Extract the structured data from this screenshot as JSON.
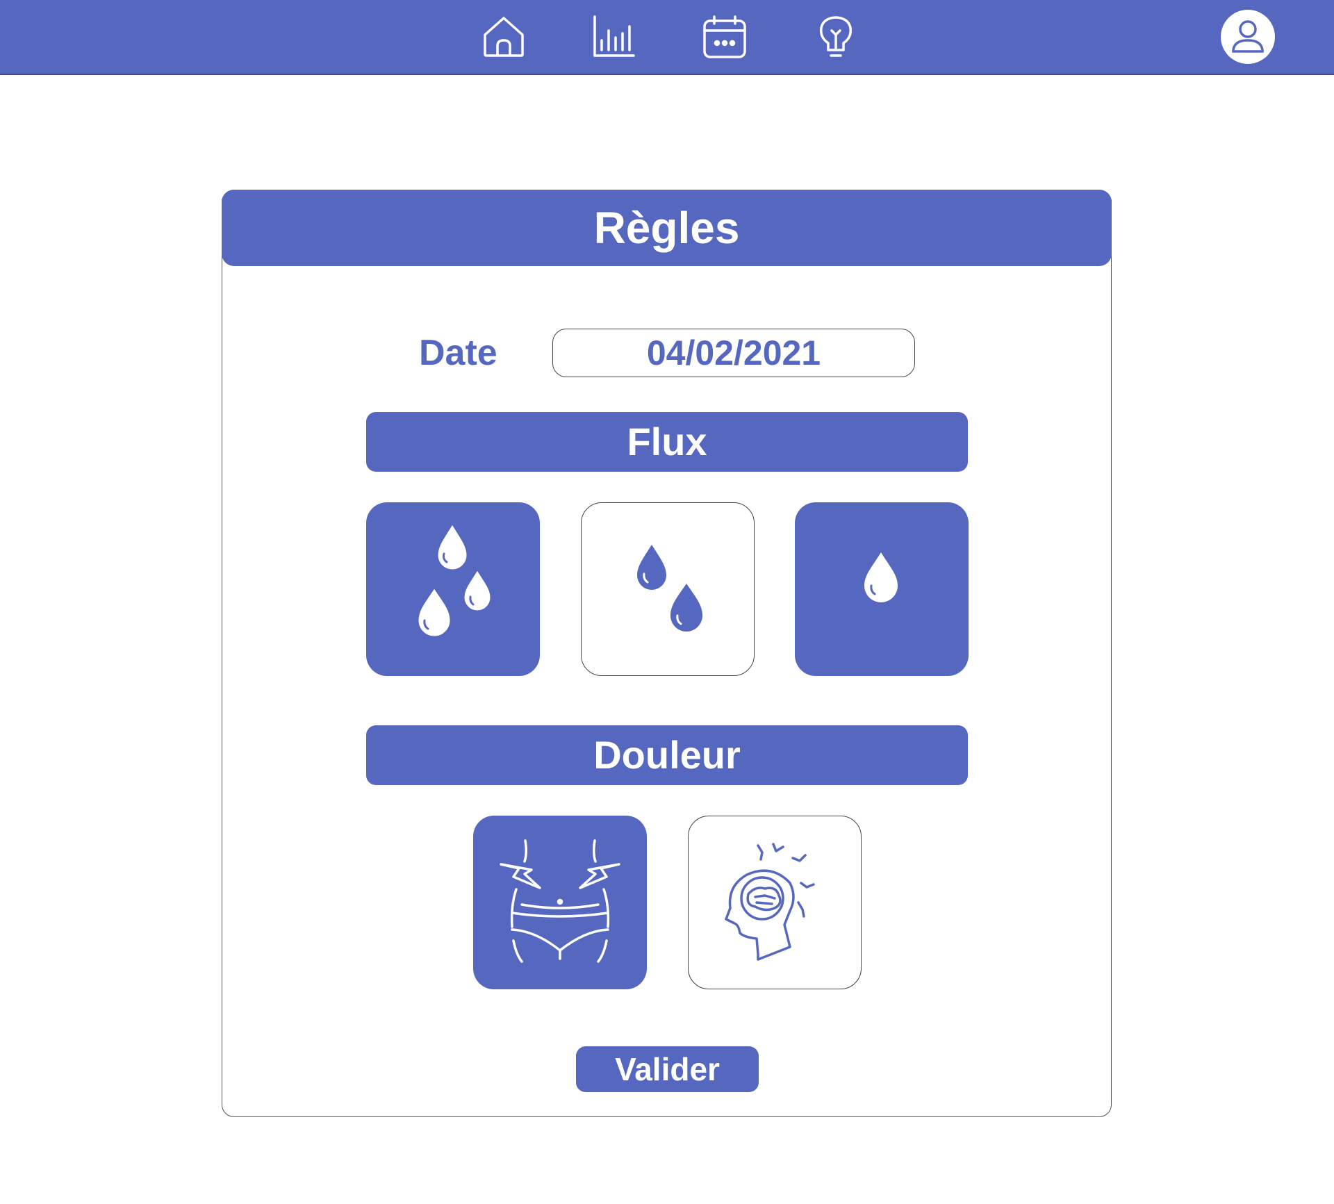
{
  "colors": {
    "accent": "#5667bf",
    "background": "#ffffff"
  },
  "nav": {
    "items": [
      {
        "icon": "home-icon"
      },
      {
        "icon": "bar-chart-icon"
      },
      {
        "icon": "calendar-icon"
      },
      {
        "icon": "lightbulb-icon"
      }
    ],
    "profile_icon": "user-icon"
  },
  "card": {
    "title": "Règles",
    "date_label": "Date",
    "date_value": "04/02/2021",
    "flux": {
      "title": "Flux",
      "options": [
        {
          "icon": "three-drops-icon",
          "selected": true
        },
        {
          "icon": "two-drops-icon",
          "selected": false
        },
        {
          "icon": "one-drop-icon",
          "selected": true
        }
      ]
    },
    "douleur": {
      "title": "Douleur",
      "options": [
        {
          "icon": "abdominal-pain-icon",
          "selected": true
        },
        {
          "icon": "headache-icon",
          "selected": false
        }
      ]
    },
    "submit_label": "Valider"
  }
}
